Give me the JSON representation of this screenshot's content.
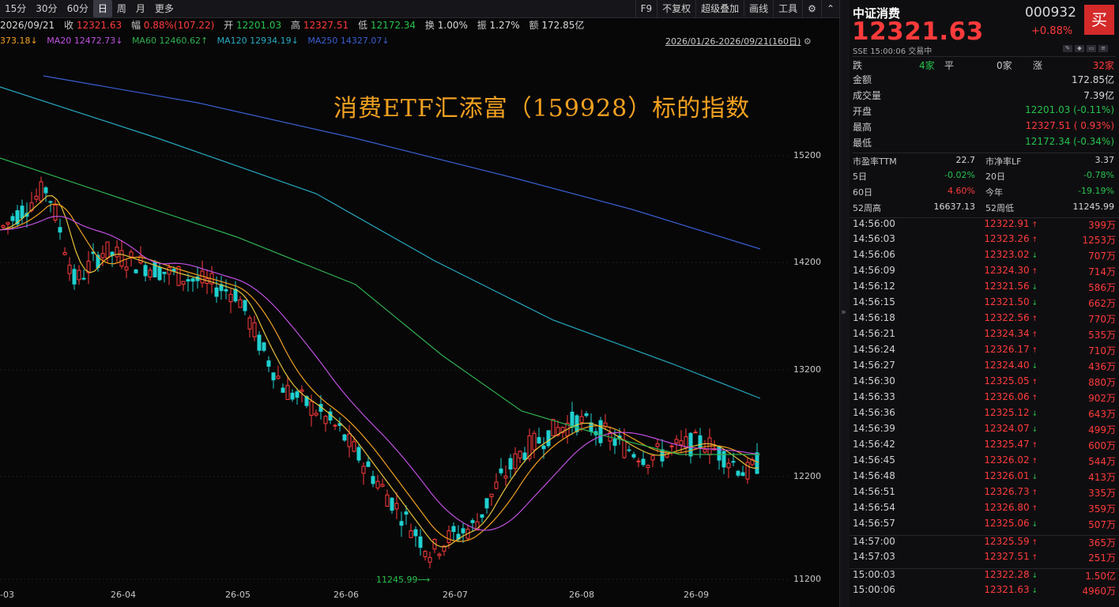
{
  "toolbar": {
    "periods": [
      "15分",
      "30分",
      "60分",
      "日",
      "周",
      "月",
      "更多"
    ],
    "active": "日",
    "right": [
      "F9",
      "不复权",
      "超级叠加",
      "画线",
      "工具"
    ]
  },
  "quote": {
    "date": "2026/09/21",
    "close_label": "收",
    "close": "12321.63",
    "amp_label": "幅",
    "amp": "0.88%(107.22)",
    "open_label": "开",
    "open": "12201.03",
    "high_label": "高",
    "high": "12327.51",
    "low_label": "低",
    "low": "12172.34",
    "turnover_label": "换",
    "turnover": "1.00%",
    "swing_label": "振",
    "swing": "1.27%",
    "amount_label": "额",
    "amount": "172.85亿"
  },
  "ma": {
    "ma10": "373.18↓",
    "ma20_label": "MA20",
    "ma20": "12472.73↓",
    "ma60_label": "MA60",
    "ma60": "12460.62↑",
    "ma120_label": "MA120",
    "ma120": "12934.19↓",
    "ma250_label": "MA250",
    "ma250": "14327.07↓",
    "range": "2026/01/26-2026/09/21(160日)"
  },
  "title": "消费ETF汇添富（159928）标的指数",
  "y_ticks": [
    "15200",
    "14200",
    "13200",
    "12200",
    "11200"
  ],
  "x_ticks": [
    "-03",
    "26-04",
    "26-05",
    "26-06",
    "26-07",
    "26-08",
    "26-09"
  ],
  "low_marker": "11245.99",
  "chart_data": {
    "type": "candlestick",
    "y_range": [
      11200,
      15200
    ],
    "ma_colors": {
      "ma5": "#e8c23a",
      "ma10": "#f0a020",
      "ma20": "#c050e0",
      "ma60": "#30b050",
      "ma120": "#27a9c0",
      "ma250": "#3a5fd0"
    },
    "up_color": "#ff3b3b",
    "down_color": "#20d0d0"
  },
  "panel": {
    "name": "中证消费",
    "code": "000932",
    "price": "12321.63",
    "change": "+0.88%",
    "buy": "买",
    "sub": "SSE  15:00:06  交易中",
    "breadth": {
      "down_label": "跌",
      "down": "4家",
      "flat_label": "平",
      "flat": "0家",
      "up_label": "涨",
      "up": "32家"
    },
    "stats": [
      {
        "label": "金额",
        "value": "172.85亿",
        "color": "#d8d8d8"
      },
      {
        "label": "成交量",
        "value": "7.39亿",
        "color": "#d8d8d8"
      },
      {
        "label": "开盘",
        "value": "12201.03 (-0.11%)",
        "color": "#27c24c"
      },
      {
        "label": "最高",
        "value": "12327.51 ( 0.93%)",
        "color": "#ff3b3b"
      },
      {
        "label": "最低",
        "value": "12172.34 (-0.34%)",
        "color": "#27c24c"
      }
    ],
    "ratios": [
      {
        "l1": "市盈率TTM",
        "v1": "22.7",
        "c1": "#d8d8d8",
        "l2": "市净率LF",
        "v2": "3.37",
        "c2": "#d8d8d8"
      },
      {
        "l1": "5日",
        "v1": "-0.02%",
        "c1": "#27c24c",
        "l2": "20日",
        "v2": "-0.78%",
        "c2": "#27c24c"
      },
      {
        "l1": "60日",
        "v1": "4.60%",
        "c1": "#ff3b3b",
        "l2": "今年",
        "v2": "-19.19%",
        "c2": "#27c24c"
      },
      {
        "l1": "52周高",
        "v1": "16637.13",
        "c1": "#d8d8d8",
        "l2": "52周低",
        "v2": "11245.99",
        "c2": "#d8d8d8"
      }
    ],
    "ticks": [
      {
        "t": "14:56:00",
        "p": "12322.91",
        "d": "up",
        "v": "399万"
      },
      {
        "t": "14:56:03",
        "p": "12323.26",
        "d": "up",
        "v": "1253万"
      },
      {
        "t": "14:56:06",
        "p": "12323.02",
        "d": "dn",
        "v": "707万"
      },
      {
        "t": "14:56:09",
        "p": "12324.30",
        "d": "up",
        "v": "714万"
      },
      {
        "t": "14:56:12",
        "p": "12321.56",
        "d": "dn",
        "v": "586万"
      },
      {
        "t": "14:56:15",
        "p": "12321.50",
        "d": "dn",
        "v": "662万"
      },
      {
        "t": "14:56:18",
        "p": "12322.56",
        "d": "up",
        "v": "770万"
      },
      {
        "t": "14:56:21",
        "p": "12324.34",
        "d": "up",
        "v": "535万"
      },
      {
        "t": "14:56:24",
        "p": "12326.17",
        "d": "up",
        "v": "710万"
      },
      {
        "t": "14:56:27",
        "p": "12324.40",
        "d": "dn",
        "v": "436万"
      },
      {
        "t": "14:56:30",
        "p": "12325.05",
        "d": "up",
        "v": "880万"
      },
      {
        "t": "14:56:33",
        "p": "12326.06",
        "d": "up",
        "v": "902万"
      },
      {
        "t": "14:56:36",
        "p": "12325.12",
        "d": "dn",
        "v": "643万"
      },
      {
        "t": "14:56:39",
        "p": "12324.07",
        "d": "dn",
        "v": "499万"
      },
      {
        "t": "14:56:42",
        "p": "12325.47",
        "d": "up",
        "v": "600万"
      },
      {
        "t": "14:56:45",
        "p": "12326.02",
        "d": "up",
        "v": "544万"
      },
      {
        "t": "14:56:48",
        "p": "12326.01",
        "d": "dn",
        "v": "413万"
      },
      {
        "t": "14:56:51",
        "p": "12326.73",
        "d": "up",
        "v": "335万"
      },
      {
        "t": "14:56:54",
        "p": "12326.80",
        "d": "up",
        "v": "359万"
      },
      {
        "t": "14:56:57",
        "p": "12325.06",
        "d": "dn",
        "v": "507万"
      },
      {
        "t": "14:57:00",
        "p": "12325.59",
        "d": "up",
        "v": "365万"
      },
      {
        "t": "14:57:03",
        "p": "12327.51",
        "d": "up",
        "v": "251万"
      },
      {
        "t": "15:00:03",
        "p": "12322.28",
        "d": "dn",
        "v": "1.50亿"
      },
      {
        "t": "15:00:06",
        "p": "12321.63",
        "d": "dn",
        "v": "4960万"
      }
    ]
  }
}
